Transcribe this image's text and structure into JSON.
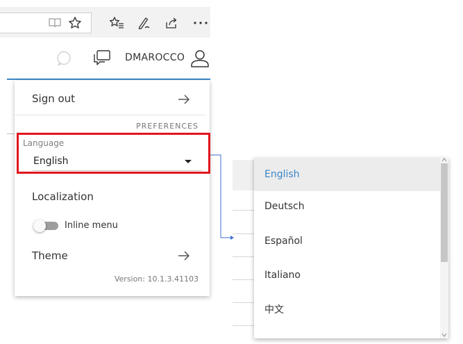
{
  "header": {
    "username": "DMAROCCO"
  },
  "menu": {
    "sign_out_label": "Sign out",
    "preferences_header": "PREFERENCES",
    "language_label": "Language",
    "language_value": "English",
    "localization_label": "Localization",
    "inline_menu_label": "Inline menu",
    "inline_menu_enabled": false,
    "theme_label": "Theme",
    "version_text": "Version: 10.1.3.41103"
  },
  "language_options": [
    "English",
    "Deutsch",
    "Español",
    "Italiano",
    "中文"
  ],
  "selected_option": "English",
  "colors": {
    "highlight_border": "#e0161d",
    "accent": "#3b86c6",
    "selected_text": "#3a86c8"
  }
}
